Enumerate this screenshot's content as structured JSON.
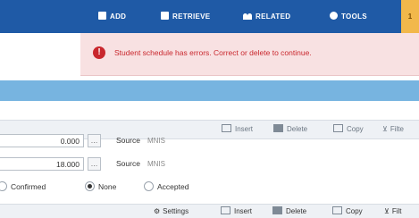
{
  "topnav": {
    "add": "ADD",
    "retrieve": "RETRIEVE",
    "related": "RELATED",
    "tools": "TOOLS",
    "side_tab": "1"
  },
  "error": {
    "message": "Student schedule has errors. Correct or delete to continue."
  },
  "toolbar_top": {
    "insert": "Insert",
    "delete": "Delete",
    "copy": "Copy",
    "filter": "Filte"
  },
  "rows": [
    {
      "value": "0.000",
      "source_label": "Source",
      "source_value": "MNIS"
    },
    {
      "value": "18.000",
      "source_label": "Source",
      "source_value": "MNIS"
    }
  ],
  "status_options": {
    "confirmed": "Confirmed",
    "none": "None",
    "accepted": "Accepted",
    "selected": "None"
  },
  "toolbar_bottom": {
    "settings": "Settings",
    "insert": "Insert",
    "delete": "Delete",
    "copy": "Copy",
    "filter": "Filt"
  }
}
